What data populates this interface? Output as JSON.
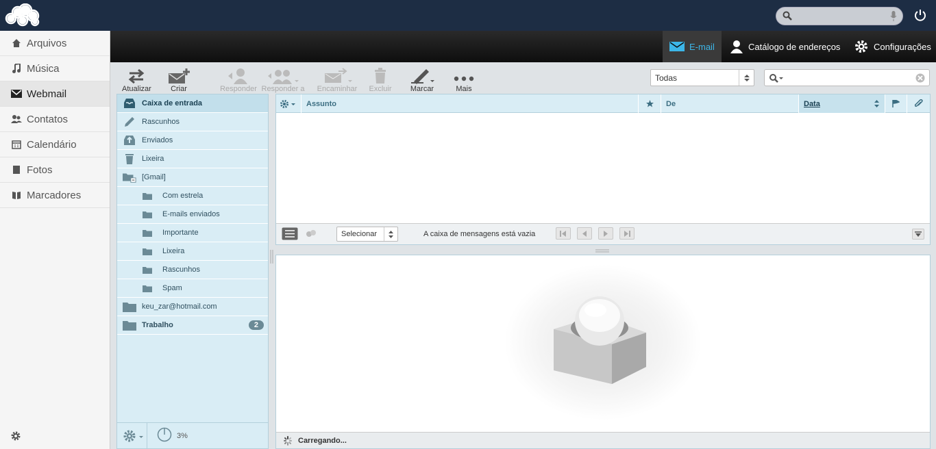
{
  "nav": {
    "items": [
      {
        "label": "Arquivos",
        "icon": "folder-icon"
      },
      {
        "label": "Música",
        "icon": "music-icon"
      },
      {
        "label": "Webmail",
        "icon": "mail-icon"
      },
      {
        "label": "Contatos",
        "icon": "contacts-icon"
      },
      {
        "label": "Calendário",
        "icon": "calendar-icon"
      },
      {
        "label": "Fotos",
        "icon": "photos-icon"
      },
      {
        "label": "Marcadores",
        "icon": "bookmarks-icon"
      }
    ]
  },
  "topnav": {
    "email": "E-mail",
    "addressbook": "Catálogo de endereços",
    "settings": "Configurações"
  },
  "toolbar": {
    "refresh": "Atualizar",
    "compose": "Criar email",
    "reply": "Responder",
    "replyall": "Responder a ...",
    "forward": "Encaminhar",
    "delete": "Excluir",
    "mark": "Marcar",
    "more": "Mais"
  },
  "filter": {
    "selected": "Todas"
  },
  "folders": {
    "items": [
      {
        "label": "Caixa de entrada"
      },
      {
        "label": "Rascunhos"
      },
      {
        "label": "Enviados"
      },
      {
        "label": "Lixeira"
      },
      {
        "label": "[Gmail]"
      },
      {
        "label": "Com estrela"
      },
      {
        "label": "E-mails enviados"
      },
      {
        "label": "Importante"
      },
      {
        "label": "Lixeira"
      },
      {
        "label": "Rascunhos"
      },
      {
        "label": "Spam"
      },
      {
        "label": "keu_zar@hotmail.com"
      },
      {
        "label": "Trabalho",
        "badge": "2"
      }
    ],
    "quota": "3%"
  },
  "list": {
    "col_subject": "Assunto",
    "col_from": "De",
    "col_date": "Data",
    "select_label": "Selecionar",
    "empty": "A caixa de mensagens está vazia"
  },
  "preview": {
    "status": "Carregando..."
  },
  "colors": {
    "topbar": "#1d2d44",
    "accent": "#3cb6e8",
    "folderbg": "#d9edf5"
  }
}
